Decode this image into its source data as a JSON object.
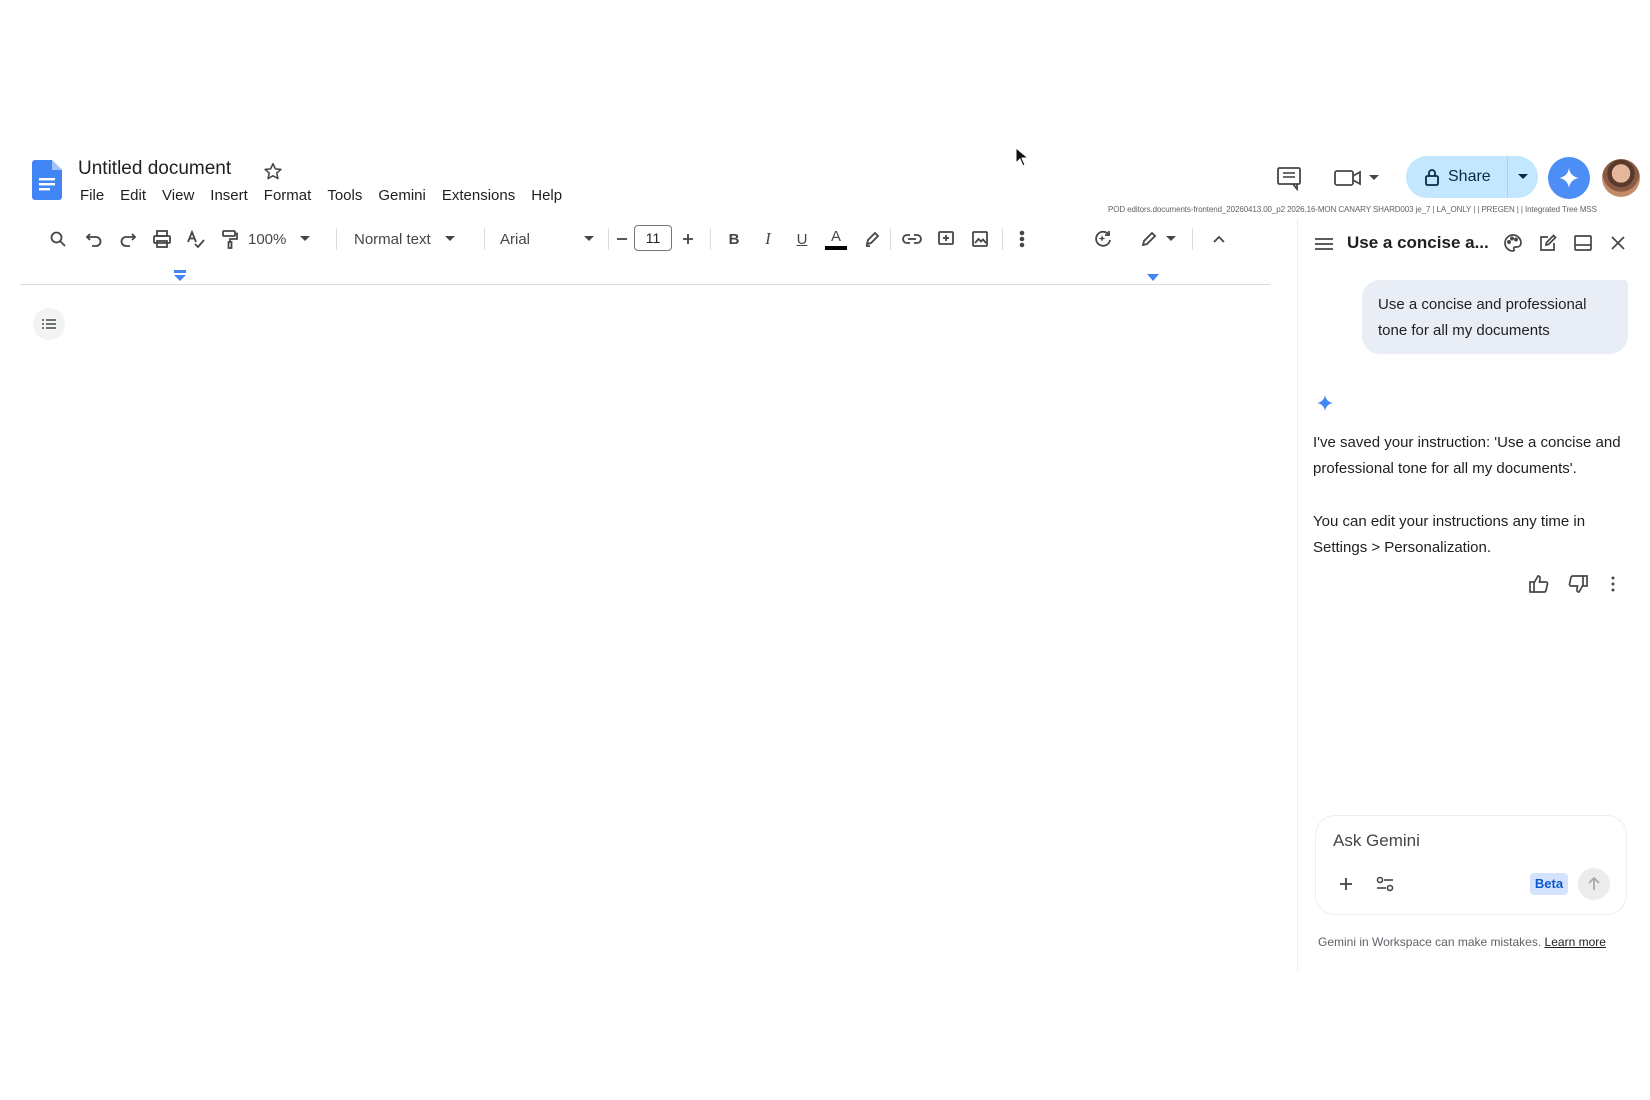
{
  "document": {
    "title": "Untitled document"
  },
  "menu": [
    "File",
    "Edit",
    "View",
    "Insert",
    "Format",
    "Tools",
    "Gemini",
    "Extensions",
    "Help"
  ],
  "header": {
    "share_label": "Share",
    "build_info": "POD editors.documents-frontend_20260413.00_p2 2026.16-MON CANARY SHARD003 je_7 | LA_ONLY | | PREGEN | | Integrated Tree   MSS"
  },
  "toolbar": {
    "zoom": "100%",
    "style": "Normal text",
    "font": "Arial",
    "font_size": "11",
    "bold": "B",
    "italic": "I",
    "underline": "U",
    "text_color": "A"
  },
  "panel": {
    "title": "Use a concise a...",
    "user_message": "Use a concise and professional tone for all my documents",
    "reply_paragraph_1": "I've saved your instruction: 'Use a concise and professional tone for all my documents'.",
    "reply_paragraph_2": "You can edit your instructions any time in Settings > Personalization.",
    "input_placeholder": "Ask Gemini",
    "beta_label": "Beta",
    "disclaimer": "Gemini in Workspace can make mistakes.",
    "learn_more": "Learn more"
  },
  "colors": {
    "accent_blue": "#0b57d0",
    "share_bg": "#c2e7ff",
    "gemini_bubble": "#e9eef6",
    "docs_blue": "#4285f4"
  },
  "icons": [
    "docs-logo-icon",
    "star-icon",
    "comments-icon",
    "meet-icon",
    "lock-icon",
    "gemini-spark-icon",
    "search-icon",
    "undo-icon",
    "redo-icon",
    "print-icon",
    "spellcheck-icon",
    "paint-format-icon",
    "link-icon",
    "comment-add-icon",
    "image-icon",
    "more-icon",
    "rewrite-icon",
    "edit-mode-icon",
    "collapse-icon",
    "outline-icon",
    "hamburger-icon",
    "palette-icon",
    "new-chat-icon",
    "dock-icon",
    "close-icon",
    "thumb-up-icon",
    "thumb-down-icon",
    "plus-icon",
    "tools-icon",
    "send-icon"
  ]
}
